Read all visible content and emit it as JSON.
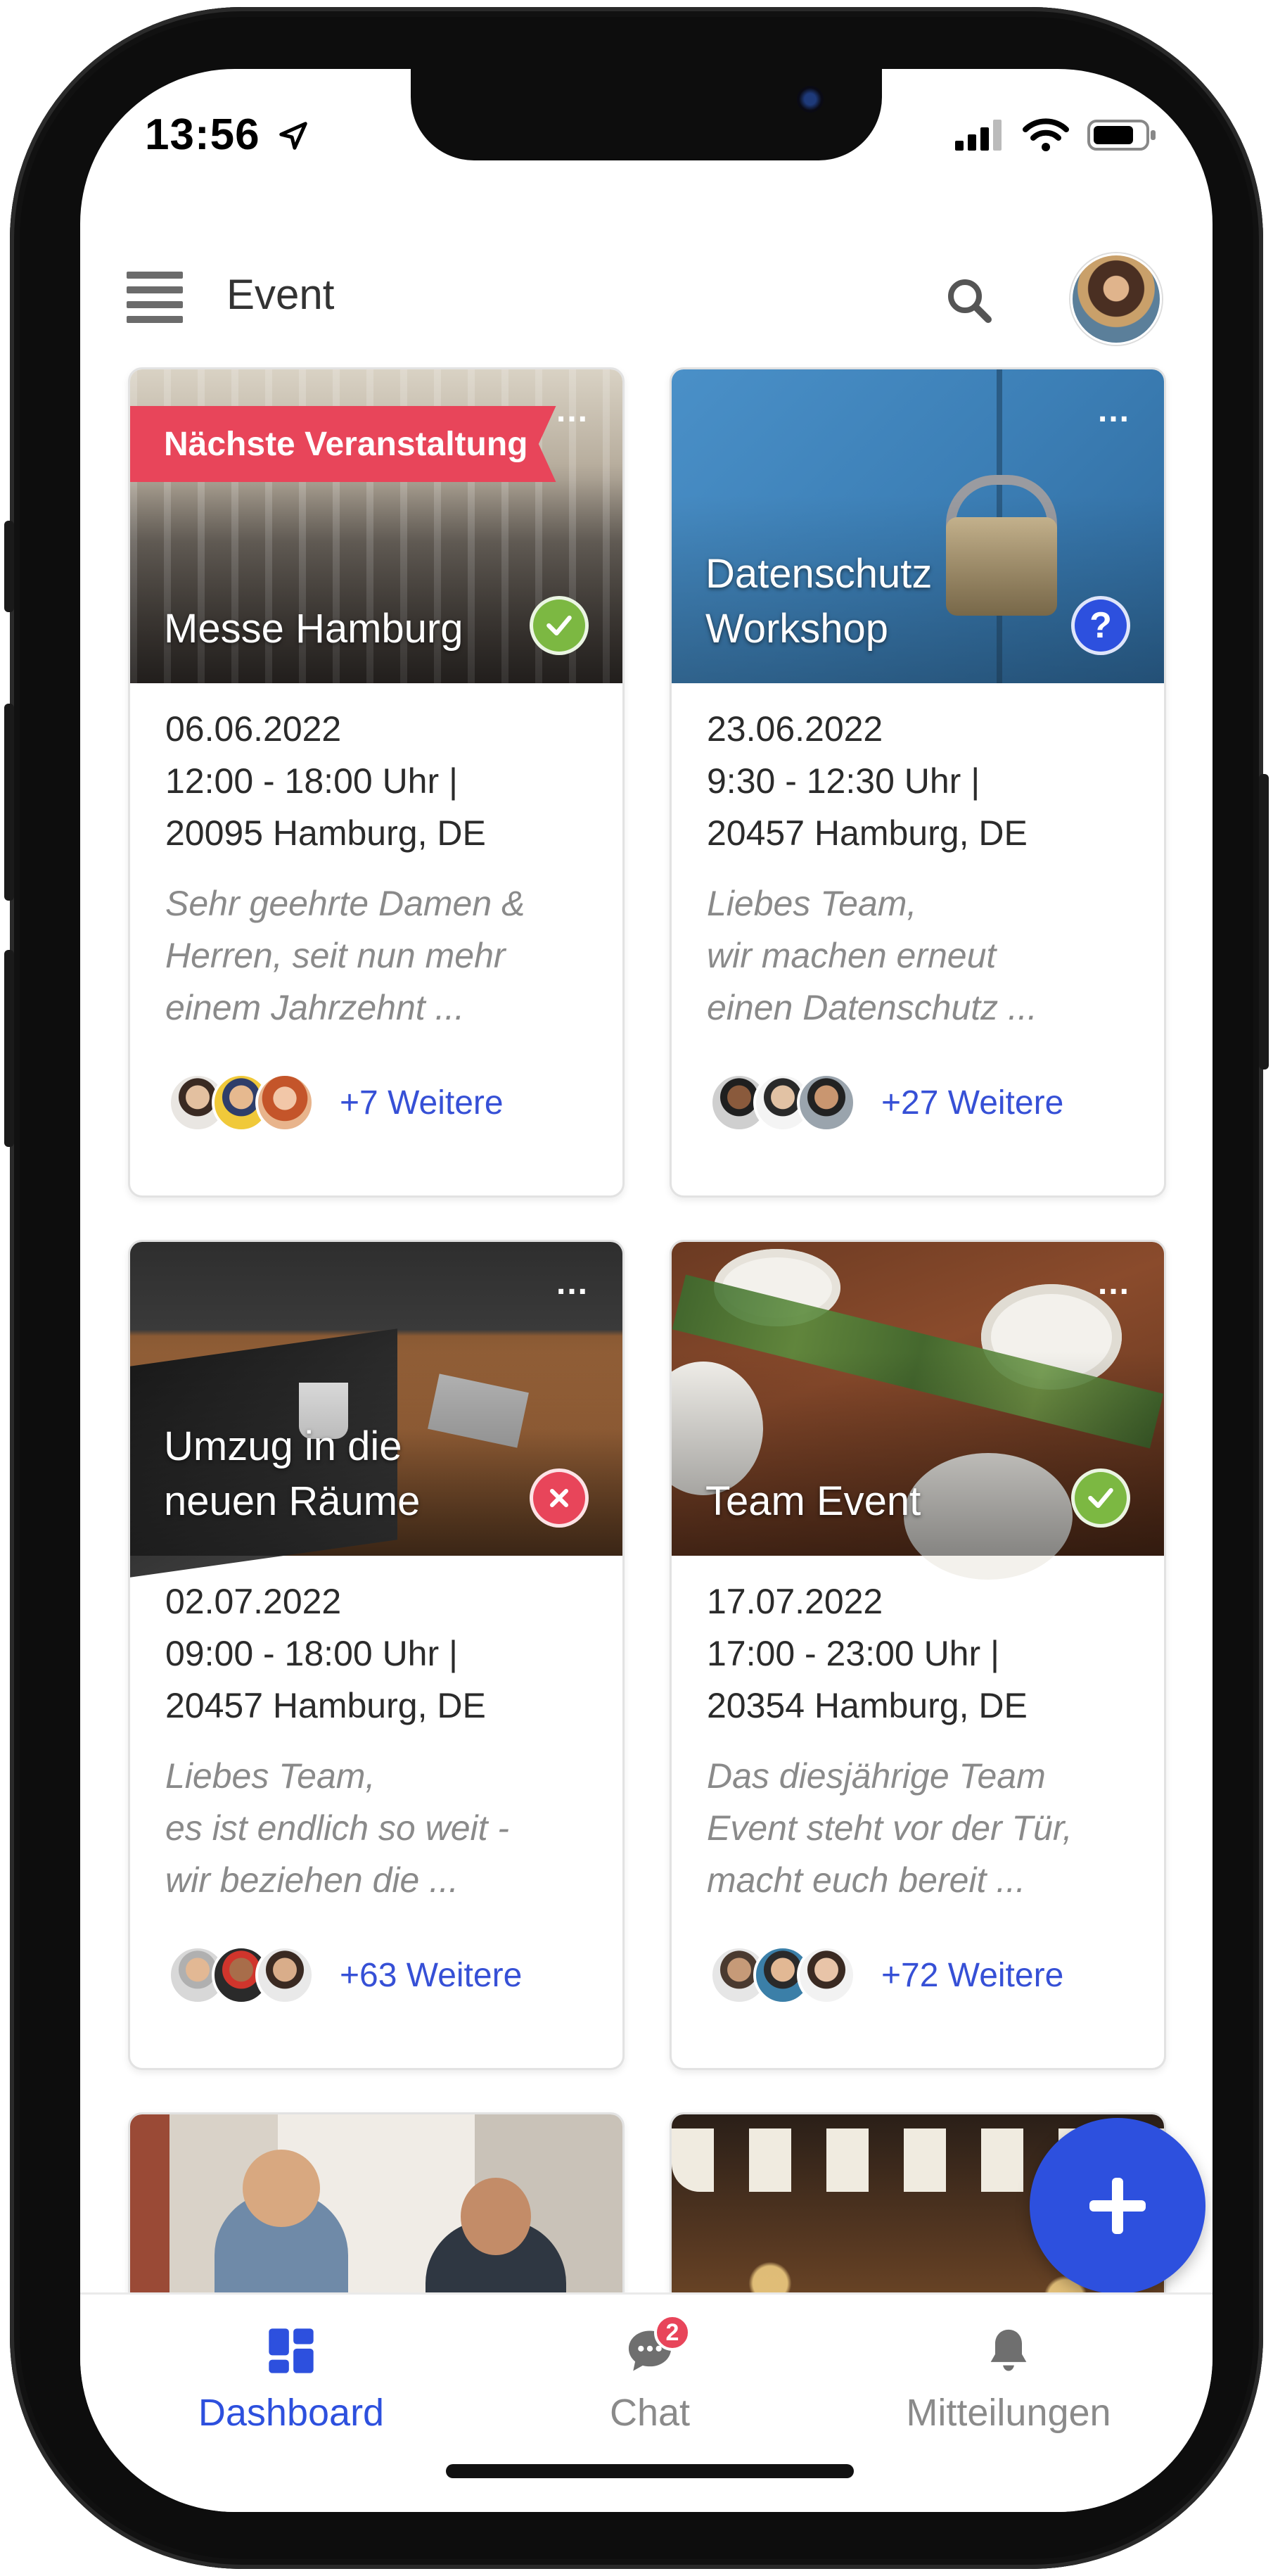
{
  "status": {
    "time": "13:56"
  },
  "header": {
    "title": "Event"
  },
  "events": [
    {
      "title": "Messe Hamburg",
      "ribbon": "Nächste Veranstaltung",
      "date": "06.06.2022",
      "time": "12:00 - 18:00 Uhr  |",
      "location": "20095 Hamburg, DE",
      "desc1": "Sehr geehrte Damen &",
      "desc2": "Herren, seit nun mehr",
      "desc3": "einem Jahrzehnt ...",
      "more": "+7 Weitere",
      "status": "accepted",
      "more_menu": "..."
    },
    {
      "title": "Datenschutz Workshop",
      "date": "23.06.2022",
      "time": "9:30 - 12:30 Uhr  |",
      "location": "20457 Hamburg, DE",
      "desc1": "Liebes Team,",
      "desc2": "wir machen erneut",
      "desc3": "einen Datenschutz ...",
      "more": "+27 Weitere",
      "status": "pending",
      "more_menu": "..."
    },
    {
      "title": "Umzug in die neuen Räume",
      "date": "02.07.2022",
      "time": "09:00 - 18:00 Uhr  |",
      "location": "20457 Hamburg, DE",
      "desc1": "Liebes Team,",
      "desc2": "es ist endlich so weit -",
      "desc3": "wir beziehen die ...",
      "more": "+63 Weitere",
      "status": "declined",
      "more_menu": "..."
    },
    {
      "title": "Team Event",
      "date": "17.07.2022",
      "time": "17:00 - 23:00 Uhr  |",
      "location": "20354 Hamburg, DE",
      "desc1": "Das diesjährige Team",
      "desc2": "Event steht vor der Tür,",
      "desc3": "macht euch bereit ...",
      "more": "+72 Weitere",
      "status": "accepted",
      "more_menu": "..."
    }
  ],
  "tabs": [
    {
      "label": "Dashboard",
      "icon": "dashboard-icon",
      "active": true
    },
    {
      "label": "Chat",
      "icon": "chat-icon",
      "badge": "2"
    },
    {
      "label": "Mitteilungen",
      "icon": "bell-icon"
    }
  ],
  "colors": {
    "accent": "#2d50de",
    "ribbon": "#e8455a",
    "ok": "#7cb842",
    "no": "#e8455a"
  }
}
